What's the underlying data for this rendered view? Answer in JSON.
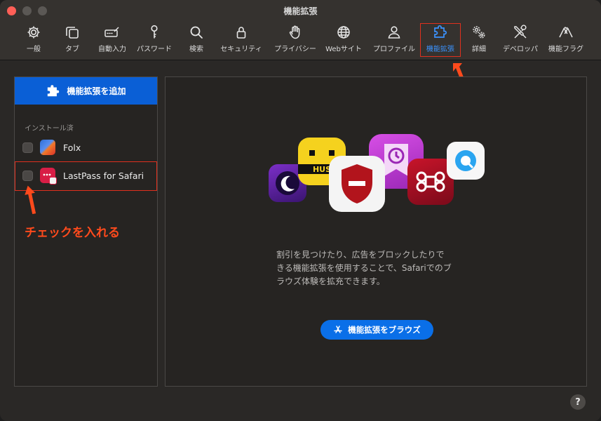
{
  "window": {
    "title": "機能拡張"
  },
  "toolbar": {
    "tabs": [
      {
        "label": "一般",
        "icon": "gear-icon"
      },
      {
        "label": "タブ",
        "icon": "tabs-icon"
      },
      {
        "label": "自動入力",
        "icon": "autofill-icon"
      },
      {
        "label": "パスワード",
        "icon": "key-icon"
      },
      {
        "label": "検索",
        "icon": "search-icon"
      },
      {
        "label": "セキュリティ",
        "icon": "lock-icon"
      },
      {
        "label": "プライバシー",
        "icon": "hand-icon"
      },
      {
        "label": "Webサイト",
        "icon": "globe-icon"
      },
      {
        "label": "プロファイル",
        "icon": "person-icon"
      },
      {
        "label": "機能拡張",
        "icon": "puzzle-icon"
      },
      {
        "label": "詳細",
        "icon": "gears-icon"
      },
      {
        "label": "デベロッパ",
        "icon": "tools-icon"
      },
      {
        "label": "機能フラグ",
        "icon": "flags-icon"
      }
    ],
    "selected": "機能拡張",
    "accent_color": "#3b93ff"
  },
  "sidebar": {
    "add_button_label": "機能拡張を追加",
    "installed_label": "インストール済",
    "extensions": [
      {
        "name": "Folx",
        "checked": false,
        "icon": "folx-app-icon"
      },
      {
        "name": "LastPass for Safari",
        "checked": false,
        "icon": "lastpass-app-icon"
      }
    ]
  },
  "main": {
    "description_lines": [
      "割引を見つけたり、広告をブロックしたりで",
      "きる機能拡張を使用することで、Safariでのブ",
      "ラウズ体験を拡充できます。"
    ],
    "browse_button_label": "機能拡張をブラウズ"
  },
  "annotations": {
    "checkbox_hint": "チェックを入れる",
    "highlight_color": "#e0301e"
  },
  "help": {
    "label": "?"
  }
}
